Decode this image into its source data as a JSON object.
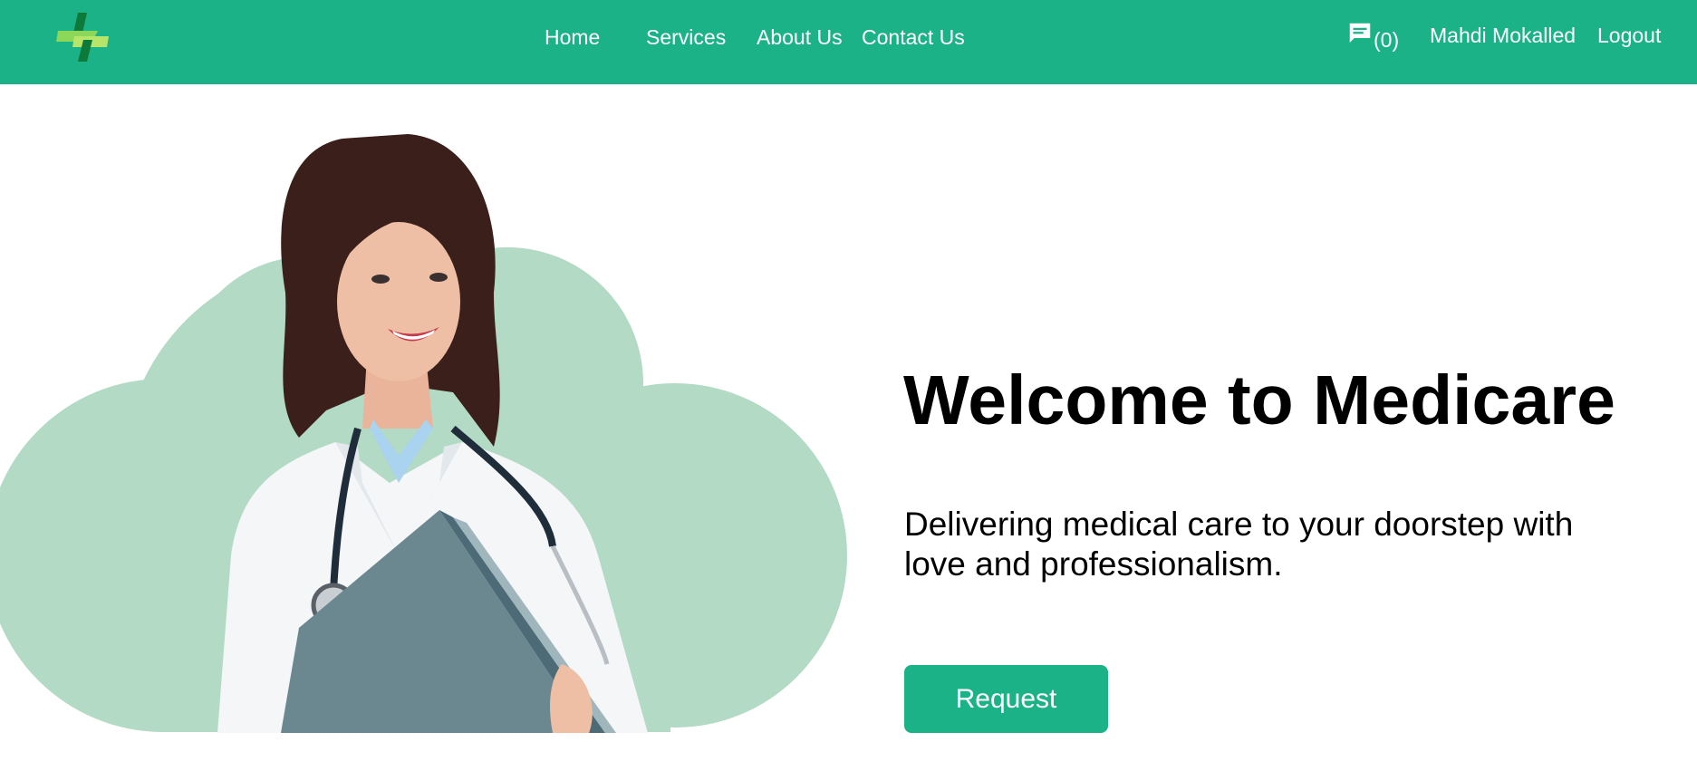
{
  "nav": {
    "logo_icon": "medical-cross-logo",
    "links": [
      "Home",
      "Services",
      "About Us",
      "Contact Us"
    ],
    "messages_icon": "chat-bubble-icon",
    "messages_count": "(0)",
    "user_name": "Mahdi Mokalled",
    "logout_label": "Logout"
  },
  "hero": {
    "title": "Welcome to Medicare",
    "subtitle": "Delivering medical care to your doorstep with love and professionalism.",
    "request_label": "Request",
    "image": "doctor-with-folder-illustration"
  },
  "colors": {
    "brand": "#1cb287",
    "cloud": "#b2dac4",
    "text": "#000000"
  }
}
